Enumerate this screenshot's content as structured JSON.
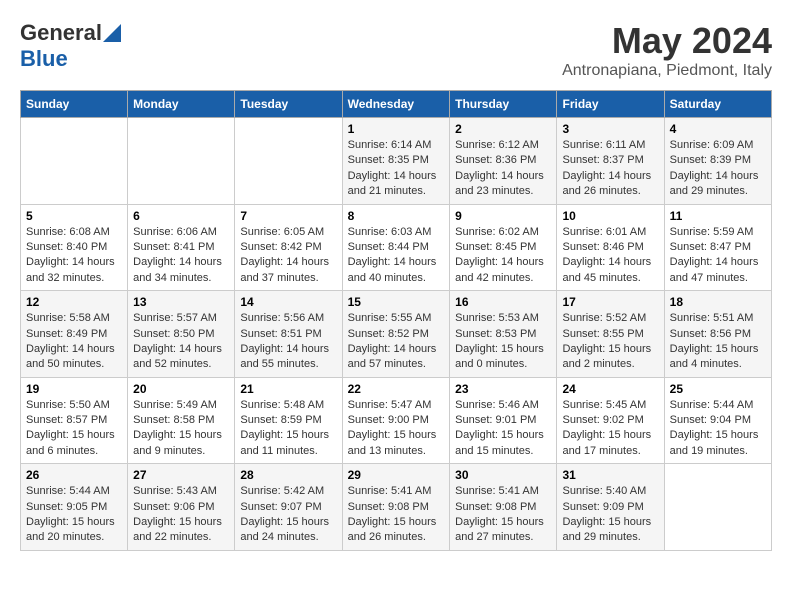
{
  "logo": {
    "general": "General",
    "blue": "Blue"
  },
  "title": "May 2024",
  "subtitle": "Antronapiana, Piedmont, Italy",
  "weekdays": [
    "Sunday",
    "Monday",
    "Tuesday",
    "Wednesday",
    "Thursday",
    "Friday",
    "Saturday"
  ],
  "weeks": [
    [
      {
        "day": "",
        "info": ""
      },
      {
        "day": "",
        "info": ""
      },
      {
        "day": "",
        "info": ""
      },
      {
        "day": "1",
        "info": "Sunrise: 6:14 AM\nSunset: 8:35 PM\nDaylight: 14 hours\nand 21 minutes."
      },
      {
        "day": "2",
        "info": "Sunrise: 6:12 AM\nSunset: 8:36 PM\nDaylight: 14 hours\nand 23 minutes."
      },
      {
        "day": "3",
        "info": "Sunrise: 6:11 AM\nSunset: 8:37 PM\nDaylight: 14 hours\nand 26 minutes."
      },
      {
        "day": "4",
        "info": "Sunrise: 6:09 AM\nSunset: 8:39 PM\nDaylight: 14 hours\nand 29 minutes."
      }
    ],
    [
      {
        "day": "5",
        "info": "Sunrise: 6:08 AM\nSunset: 8:40 PM\nDaylight: 14 hours\nand 32 minutes."
      },
      {
        "day": "6",
        "info": "Sunrise: 6:06 AM\nSunset: 8:41 PM\nDaylight: 14 hours\nand 34 minutes."
      },
      {
        "day": "7",
        "info": "Sunrise: 6:05 AM\nSunset: 8:42 PM\nDaylight: 14 hours\nand 37 minutes."
      },
      {
        "day": "8",
        "info": "Sunrise: 6:03 AM\nSunset: 8:44 PM\nDaylight: 14 hours\nand 40 minutes."
      },
      {
        "day": "9",
        "info": "Sunrise: 6:02 AM\nSunset: 8:45 PM\nDaylight: 14 hours\nand 42 minutes."
      },
      {
        "day": "10",
        "info": "Sunrise: 6:01 AM\nSunset: 8:46 PM\nDaylight: 14 hours\nand 45 minutes."
      },
      {
        "day": "11",
        "info": "Sunrise: 5:59 AM\nSunset: 8:47 PM\nDaylight: 14 hours\nand 47 minutes."
      }
    ],
    [
      {
        "day": "12",
        "info": "Sunrise: 5:58 AM\nSunset: 8:49 PM\nDaylight: 14 hours\nand 50 minutes."
      },
      {
        "day": "13",
        "info": "Sunrise: 5:57 AM\nSunset: 8:50 PM\nDaylight: 14 hours\nand 52 minutes."
      },
      {
        "day": "14",
        "info": "Sunrise: 5:56 AM\nSunset: 8:51 PM\nDaylight: 14 hours\nand 55 minutes."
      },
      {
        "day": "15",
        "info": "Sunrise: 5:55 AM\nSunset: 8:52 PM\nDaylight: 14 hours\nand 57 minutes."
      },
      {
        "day": "16",
        "info": "Sunrise: 5:53 AM\nSunset: 8:53 PM\nDaylight: 15 hours\nand 0 minutes."
      },
      {
        "day": "17",
        "info": "Sunrise: 5:52 AM\nSunset: 8:55 PM\nDaylight: 15 hours\nand 2 minutes."
      },
      {
        "day": "18",
        "info": "Sunrise: 5:51 AM\nSunset: 8:56 PM\nDaylight: 15 hours\nand 4 minutes."
      }
    ],
    [
      {
        "day": "19",
        "info": "Sunrise: 5:50 AM\nSunset: 8:57 PM\nDaylight: 15 hours\nand 6 minutes."
      },
      {
        "day": "20",
        "info": "Sunrise: 5:49 AM\nSunset: 8:58 PM\nDaylight: 15 hours\nand 9 minutes."
      },
      {
        "day": "21",
        "info": "Sunrise: 5:48 AM\nSunset: 8:59 PM\nDaylight: 15 hours\nand 11 minutes."
      },
      {
        "day": "22",
        "info": "Sunrise: 5:47 AM\nSunset: 9:00 PM\nDaylight: 15 hours\nand 13 minutes."
      },
      {
        "day": "23",
        "info": "Sunrise: 5:46 AM\nSunset: 9:01 PM\nDaylight: 15 hours\nand 15 minutes."
      },
      {
        "day": "24",
        "info": "Sunrise: 5:45 AM\nSunset: 9:02 PM\nDaylight: 15 hours\nand 17 minutes."
      },
      {
        "day": "25",
        "info": "Sunrise: 5:44 AM\nSunset: 9:04 PM\nDaylight: 15 hours\nand 19 minutes."
      }
    ],
    [
      {
        "day": "26",
        "info": "Sunrise: 5:44 AM\nSunset: 9:05 PM\nDaylight: 15 hours\nand 20 minutes."
      },
      {
        "day": "27",
        "info": "Sunrise: 5:43 AM\nSunset: 9:06 PM\nDaylight: 15 hours\nand 22 minutes."
      },
      {
        "day": "28",
        "info": "Sunrise: 5:42 AM\nSunset: 9:07 PM\nDaylight: 15 hours\nand 24 minutes."
      },
      {
        "day": "29",
        "info": "Sunrise: 5:41 AM\nSunset: 9:08 PM\nDaylight: 15 hours\nand 26 minutes."
      },
      {
        "day": "30",
        "info": "Sunrise: 5:41 AM\nSunset: 9:08 PM\nDaylight: 15 hours\nand 27 minutes."
      },
      {
        "day": "31",
        "info": "Sunrise: 5:40 AM\nSunset: 9:09 PM\nDaylight: 15 hours\nand 29 minutes."
      },
      {
        "day": "",
        "info": ""
      }
    ]
  ]
}
